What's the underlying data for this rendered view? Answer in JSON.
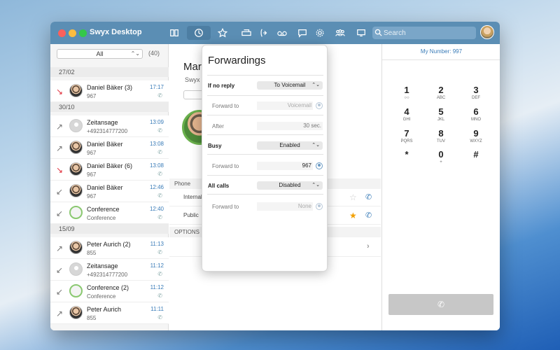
{
  "app": {
    "title": "Swyx Desktop"
  },
  "search": {
    "placeholder": "Search"
  },
  "colors": {
    "titlebar": "#5b8eb4",
    "accent": "#3a7cb8",
    "missed": "#e0303c",
    "favorite": "#f2a000"
  },
  "icons": [
    "book-icon",
    "history-icon",
    "star-icon",
    "phone-office-icon",
    "forwarding-icon",
    "voicemail-icon",
    "chat-icon",
    "gear-icon",
    "group-icon",
    "desk-icon",
    "search-icon"
  ],
  "call_list": {
    "filter": "All",
    "count": "(40)",
    "sections": [
      {
        "date": "27/02",
        "calls": [
          {
            "name": "Daniel Bäker (3)",
            "number": "967",
            "time": "17:17",
            "type": "missed",
            "avatar": "photo"
          }
        ]
      },
      {
        "date": "30/10",
        "calls": [
          {
            "name": "Zeitansage",
            "number": "+492314777200",
            "time": "13:09",
            "type": "outgoing",
            "avatar": "grey"
          },
          {
            "name": "Daniel Bäker",
            "number": "967",
            "time": "13:08",
            "type": "outgoing",
            "avatar": "photo"
          },
          {
            "name": "Daniel Bäker (6)",
            "number": "967",
            "time": "13:08",
            "type": "missed",
            "avatar": "photo"
          },
          {
            "name": "Daniel Bäker",
            "number": "967",
            "time": "12:46",
            "type": "incoming",
            "avatar": "photo"
          },
          {
            "name": "Conference",
            "number": "Conference",
            "time": "12:40",
            "type": "incoming",
            "avatar": "conf"
          }
        ]
      },
      {
        "date": "15/09",
        "calls": [
          {
            "name": "Peter Aurich (2)",
            "number": "855",
            "time": "11:13",
            "type": "outgoing",
            "avatar": "photo"
          },
          {
            "name": "Zeitansage",
            "number": "+492314777200",
            "time": "11:12",
            "type": "incoming",
            "avatar": "grey"
          },
          {
            "name": "Conference (2)",
            "number": "Conference",
            "time": "11:12",
            "type": "incoming",
            "avatar": "conf"
          },
          {
            "name": "Peter Aurich",
            "number": "855",
            "time": "11:11",
            "type": "outgoing",
            "avatar": "photo"
          }
        ]
      }
    ]
  },
  "contact": {
    "name": "Mar",
    "sub": "Swyx",
    "phone_header": "Phone",
    "phones": [
      {
        "label": "Internal",
        "favorite": false
      },
      {
        "label": "Public",
        "favorite": true
      }
    ],
    "options_header": "OPTIONS"
  },
  "forwardings": {
    "title": "Forwardings",
    "no_reply": {
      "label": "If no reply",
      "mode": "To Voicemail",
      "forward_to_label": "Forward to",
      "forward_to": "Voicemail",
      "after_label": "After",
      "after": "30 sec."
    },
    "busy": {
      "label": "Busy",
      "mode": "Enabled",
      "forward_to_label": "Forward to",
      "forward_to": "967"
    },
    "all_calls": {
      "label": "All calls",
      "mode": "Disabled",
      "forward_to_label": "Forward to",
      "forward_to": "None"
    }
  },
  "dialer": {
    "my_number": "My Number: 997",
    "keys": [
      {
        "d": "1",
        "l": "○○"
      },
      {
        "d": "2",
        "l": "ABC"
      },
      {
        "d": "3",
        "l": "DEF"
      },
      {
        "d": "4",
        "l": "GHI"
      },
      {
        "d": "5",
        "l": "JKL"
      },
      {
        "d": "6",
        "l": "MNO"
      },
      {
        "d": "7",
        "l": "PQRS"
      },
      {
        "d": "8",
        "l": "TUV"
      },
      {
        "d": "9",
        "l": "WXYZ"
      },
      {
        "d": "*",
        "l": ""
      },
      {
        "d": "0",
        "l": "+"
      },
      {
        "d": "#",
        "l": ""
      }
    ]
  }
}
